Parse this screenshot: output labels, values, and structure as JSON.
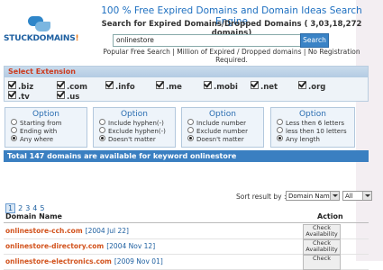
{
  "header": {
    "logo_text_main": "STUCKDOMAINS",
    "logo_text_accent": "!",
    "title": "100 % Free Expired Domains and Domain Ideas Search Engine",
    "subtitle": "Search for Expired Domains/Dropped Domains ( 3,03,18,272 domains)",
    "tagline": "Popular Free Search | Million of Expired / Dropped domains | No Registration Required."
  },
  "search": {
    "value": "onlinestore",
    "button_label": "Search"
  },
  "extensions": {
    "heading": "Select Extension",
    "items": [
      ".biz",
      ".com",
      ".info",
      ".me",
      ".mobi",
      ".net",
      ".org",
      ".tv",
      ".us"
    ]
  },
  "options": [
    {
      "title": "Option",
      "choices": [
        "Starting from",
        "Ending with",
        "Any where"
      ],
      "selected": 2
    },
    {
      "title": "Option",
      "choices": [
        "Include hyphen(-)",
        "Exclude hyphen(-)",
        "Doesn't matter"
      ],
      "selected": 2
    },
    {
      "title": "Option",
      "choices": [
        "Include number",
        "Exclude number",
        "Doesn't matter"
      ],
      "selected": 2
    },
    {
      "title": "Option",
      "choices": [
        "Less then 6 letters",
        "less then 10 letters",
        "Any length"
      ],
      "selected": 2
    }
  ],
  "results": {
    "total_text": "Total 147 domains are available for keyword onlinestore",
    "sort_label": "Sort result by :",
    "sort_value": "Domain Name",
    "filter_value": "All",
    "pages": [
      "1",
      "2",
      "3",
      "4",
      "5"
    ],
    "current_page": "1",
    "col_domain": "Domain Name",
    "col_action": "Action",
    "rows": [
      {
        "domain": "onlinestore-cch.com",
        "date": "[2004 Jul 22]",
        "action": "Check Availability"
      },
      {
        "domain": "onlinestore-directory.com",
        "date": "[2004 Nov 12]",
        "action": "Check Availability"
      },
      {
        "domain": "onlinestore-electronics.com",
        "date": "[2009 Nov 01]",
        "action": "Check"
      }
    ]
  },
  "colors": {
    "accent_blue": "#3a7fc1",
    "domain_orange": "#d2521c",
    "heading_red": "#cc3a1e"
  }
}
